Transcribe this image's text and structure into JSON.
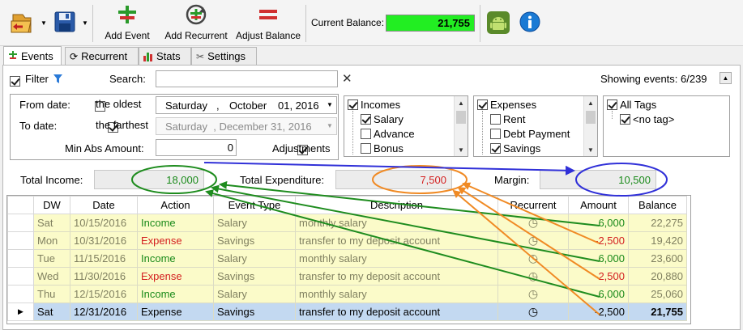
{
  "toolbar": {
    "add_event": "Add Event",
    "add_recurrent": "Add Recurrent",
    "adjust_balance": "Adjust Balance",
    "current_balance_label": "Current Balance:",
    "current_balance_value": "21,755"
  },
  "tabs": [
    "Events",
    "Recurrent",
    "Stats",
    "Settings"
  ],
  "filter": {
    "filter_label": "Filter",
    "search_label": "Search:",
    "search_value": "",
    "showing": "Showing events: 6/239",
    "from_date_label": "From date:",
    "oldest_label": "the oldest",
    "from_date": {
      "day": "Saturday",
      "sep": ",",
      "month": "October",
      "date": "01, 2016"
    },
    "to_date_label": "To date:",
    "farthest_label": "the farthest",
    "to_date": "Saturday  , December 31, 2016",
    "min_abs_label": "Min Abs Amount:",
    "min_abs_value": "0",
    "adjustments_label": "Adjustments",
    "incomes": {
      "header": "Incomes",
      "items": [
        "Salary",
        "Advance",
        "Bonus"
      ],
      "checked": [
        true,
        false,
        false
      ]
    },
    "expenses": {
      "header": "Expenses",
      "items": [
        "Rent",
        "Debt Payment",
        "Savings"
      ],
      "checked": [
        false,
        false,
        true
      ]
    },
    "tags": {
      "header": "All Tags",
      "items": [
        "<no tag>"
      ]
    }
  },
  "totals": {
    "income_label": "Total Income:",
    "income_value": "18,000",
    "expenditure_label": "Total Expenditure:",
    "expenditure_value": "7,500",
    "margin_label": "Margin:",
    "margin_value": "10,500"
  },
  "grid": {
    "columns": [
      "DW",
      "Date",
      "Action",
      "Event Type",
      "Description",
      "Recurrent",
      "Amount",
      "Balance"
    ],
    "rows": [
      {
        "dw": "Sat",
        "date": "10/15/2016",
        "action": "Income",
        "type": "Salary",
        "desc": "monthly salary",
        "amount": "6,000",
        "balance": "22,275"
      },
      {
        "dw": "Mon",
        "date": "10/31/2016",
        "action": "Expense",
        "type": "Savings",
        "desc": "transfer to my deposit account",
        "amount": "-2,500",
        "balance": "19,420"
      },
      {
        "dw": "Tue",
        "date": "11/15/2016",
        "action": "Income",
        "type": "Salary",
        "desc": "monthly salary",
        "amount": "6,000",
        "balance": "23,600"
      },
      {
        "dw": "Wed",
        "date": "11/30/2016",
        "action": "Expense",
        "type": "Savings",
        "desc": "transfer to my deposit account",
        "amount": "-2,500",
        "balance": "20,880"
      },
      {
        "dw": "Thu",
        "date": "12/15/2016",
        "action": "Income",
        "type": "Salary",
        "desc": "monthly salary",
        "amount": "6,000",
        "balance": "25,060"
      },
      {
        "dw": "Sat",
        "date": "12/31/2016",
        "action": "Expense",
        "type": "Savings",
        "desc": "transfer to my deposit account",
        "amount": "-2,500",
        "balance": "21,755"
      }
    ]
  },
  "colors": {
    "balance_bg": "#22ee22",
    "income": "#1a8a1a",
    "expense": "#d42020",
    "green_ann": "#1e8c1e",
    "orange_ann": "#f08a24",
    "blue_ann": "#3030d8"
  },
  "icons": [
    "open-folder-icon",
    "save-icon",
    "add-event-icon",
    "add-recurrent-icon",
    "adjust-balance-icon",
    "android-icon",
    "info-icon",
    "filter-funnel-icon",
    "clear-x-icon",
    "recurrent-clock-icon",
    "collapse-up-icon"
  ]
}
